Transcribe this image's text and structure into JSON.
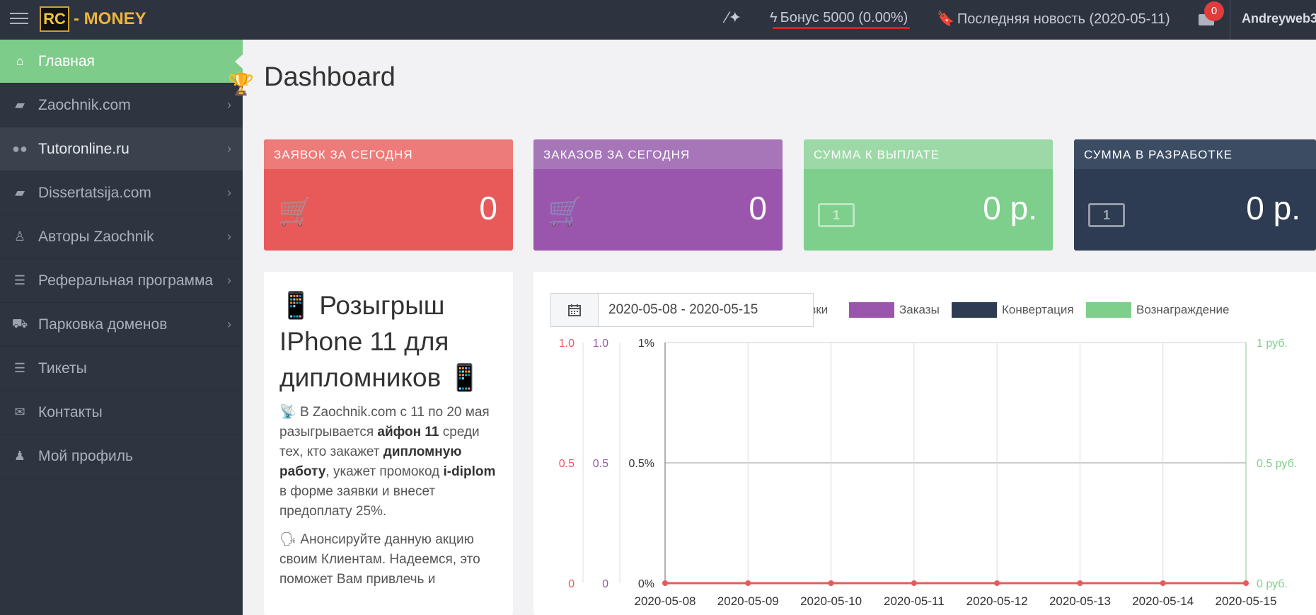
{
  "topbar": {
    "logo_text": "- MONEY",
    "logo_mark": "RC",
    "bonus": "Бонус 5000 (0.00%)",
    "news": "Последняя новость (2020-05-11)",
    "mail_badge": "0",
    "user": "Andreyweb3"
  },
  "sidebar": {
    "items": [
      {
        "label": "Главная",
        "icon": "home-icon"
      },
      {
        "label": "Zaochnik.com",
        "icon": "book-icon"
      },
      {
        "label": "Tutoronline.ru",
        "icon": "users-icon"
      },
      {
        "label": "Dissertatsija.com",
        "icon": "book-icon"
      },
      {
        "label": "Авторы Zaochnik",
        "icon": "person-icon"
      },
      {
        "label": "Реферальная программа",
        "icon": "list-icon"
      },
      {
        "label": "Парковка доменов",
        "icon": "truck-icon"
      },
      {
        "label": "Тикеты",
        "icon": "ticket-icon"
      },
      {
        "label": "Контакты",
        "icon": "envelope-icon"
      },
      {
        "label": "Мой профиль",
        "icon": "user-icon"
      }
    ]
  },
  "page": {
    "title": "Dashboard"
  },
  "cards": [
    {
      "header": "ЗАЯВОК ЗА СЕГОДНЯ",
      "value": "0",
      "color": "#e85a5a"
    },
    {
      "header": "ЗАКАЗОВ ЗА СЕГОДНЯ",
      "value": "0",
      "color": "#9a56ad"
    },
    {
      "header": "СУММА К ВЫПЛАТЕ",
      "value": "0 р.",
      "color": "#7dcf8b"
    },
    {
      "header": "СУММА В РАЗРАБОТКЕ",
      "value": "0 р.",
      "color": "#2d3c52"
    }
  ],
  "promo": {
    "title": "Розыгрыш IPhone 11 для дипломников",
    "p1_a": "В Zaochnik.com с 11 по 20 мая разыгрывается ",
    "p1_b": "айфон 11",
    "p1_c": " среди тех, кто закажет ",
    "p1_d": "дипломную работу",
    "p1_e": ", укажет промокод ",
    "p1_f": "i-diplom",
    "p1_g": " в форме заявки и внесет предоплату 25%.",
    "p2": "Анонсируйте данную акцию своим Клиентам. Надеемся, это поможет Вам привлечь и"
  },
  "date_range": "2020-05-08 - 2020-05-15",
  "chart_data": {
    "type": "line",
    "x": [
      "2020-05-08",
      "2020-05-09",
      "2020-05-10",
      "2020-05-11",
      "2020-05-12",
      "2020-05-13",
      "2020-05-14",
      "2020-05-15"
    ],
    "series": [
      {
        "name": "Заявки",
        "color": "#e85a5a",
        "values": [
          0,
          0,
          0,
          0,
          0,
          0,
          0,
          0
        ]
      },
      {
        "name": "Заказы",
        "color": "#9a56ad",
        "values": [
          0,
          0,
          0,
          0,
          0,
          0,
          0,
          0
        ]
      },
      {
        "name": "Конвертация",
        "color": "#2d3c52",
        "values": [
          0,
          0,
          0,
          0,
          0,
          0,
          0,
          0
        ]
      },
      {
        "name": "Вознаграждение",
        "color": "#7dcf8b",
        "values": [
          0,
          0,
          0,
          0,
          0,
          0,
          0,
          0
        ]
      }
    ],
    "legend_visible": [
      "явки",
      "Заказы",
      "Конвертация",
      "Вознаграждение"
    ],
    "axes": {
      "left1": {
        "ticks": [
          "1.0",
          "0.5",
          "0"
        ],
        "color": "#e85a5a"
      },
      "left2": {
        "ticks": [
          "1.0",
          "0.5",
          "0"
        ],
        "color": "#9a56ad"
      },
      "left3": {
        "ticks": [
          "1%",
          "0.5%",
          "0%"
        ],
        "color": "#333333"
      },
      "right": {
        "ticks": [
          "1 руб.",
          "0.5 руб.",
          "0 руб."
        ],
        "color": "#7dcf8b"
      }
    },
    "ylim": [
      0,
      1
    ],
    "legend_position": "top"
  }
}
